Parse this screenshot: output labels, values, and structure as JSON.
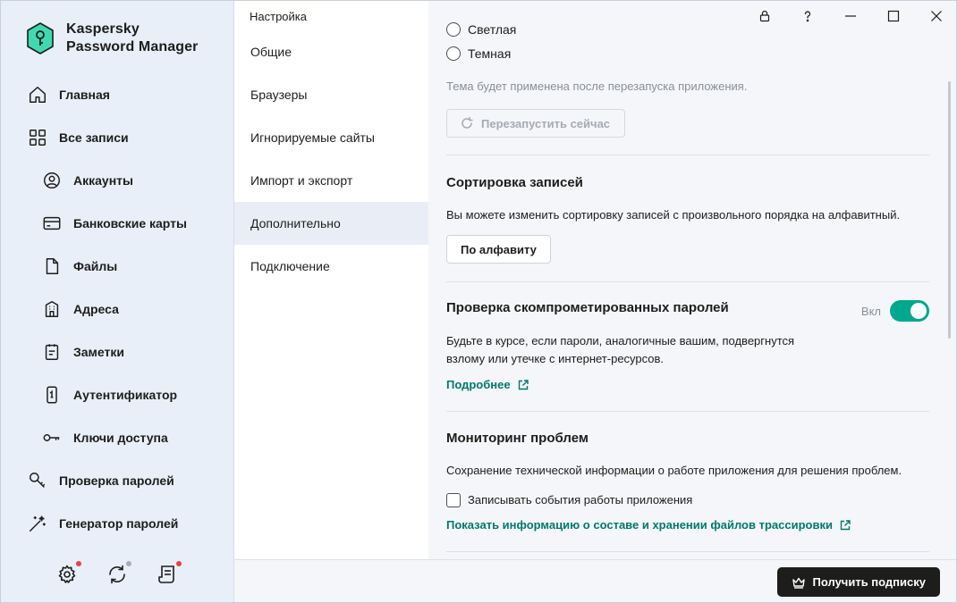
{
  "app": {
    "brand_line1": "Kaspersky",
    "brand_line2": "Password Manager",
    "window_title": "Настройка",
    "accent_color": "#00a88e",
    "link_color": "#00796b"
  },
  "sidebar": {
    "items": [
      {
        "label": "Главная",
        "icon": "home-icon"
      },
      {
        "label": "Все записи",
        "icon": "grid-icon"
      },
      {
        "label": "Аккаунты",
        "icon": "user-circle-icon"
      },
      {
        "label": "Банковские карты",
        "icon": "credit-card-icon"
      },
      {
        "label": "Файлы",
        "icon": "file-icon"
      },
      {
        "label": "Адреса",
        "icon": "building-icon"
      },
      {
        "label": "Заметки",
        "icon": "notepad-icon"
      },
      {
        "label": "Аутентификатор",
        "icon": "phone-icon"
      },
      {
        "label": "Ключи доступа",
        "icon": "key-icon"
      },
      {
        "label": "Проверка паролей",
        "icon": "password-check-icon"
      },
      {
        "label": "Генератор паролей",
        "icon": "magic-wand-icon"
      }
    ],
    "bottom": [
      {
        "icon": "settings-gear-icon",
        "dot_color": "#e8413c"
      },
      {
        "icon": "sync-icon",
        "dot_color": "#a9adb3"
      },
      {
        "icon": "news-icon",
        "dot_color": "#e8413c"
      }
    ]
  },
  "settings_nav": {
    "items": [
      {
        "label": "Общие"
      },
      {
        "label": "Браузеры"
      },
      {
        "label": "Игнорируемые сайты"
      },
      {
        "label": "Импорт и экспорт"
      },
      {
        "label": "Дополнительно"
      },
      {
        "label": "Подключение"
      }
    ]
  },
  "content": {
    "theme": {
      "option_light": "Светлая",
      "option_dark": "Темная",
      "hint": "Тема будет применена после перезапуска приложения.",
      "restart_button": "Перезапустить сейчас"
    },
    "sorting": {
      "title": "Сортировка записей",
      "text": "Вы можете изменить сортировку записей с произвольного порядка на алфавитный.",
      "button": "По алфавиту"
    },
    "compromised": {
      "title": "Проверка скомпрометированных паролей",
      "toggle_label": "Вкл",
      "text_line1": "Будьте в курсе, если пароли, аналогичные вашим, подвергнутся",
      "text_line2": "взлому или утечке с интернет-ресурсов.",
      "link": "Подробнее"
    },
    "monitoring": {
      "title": "Мониторинг проблем",
      "text": "Сохранение технической информации о работе приложения для решения проблем.",
      "checkbox": "Записывать события работы приложения",
      "link": "Показать информацию о составе и хранении файлов трассировки"
    }
  },
  "footer": {
    "subscribe_button": "Получить подписку"
  }
}
